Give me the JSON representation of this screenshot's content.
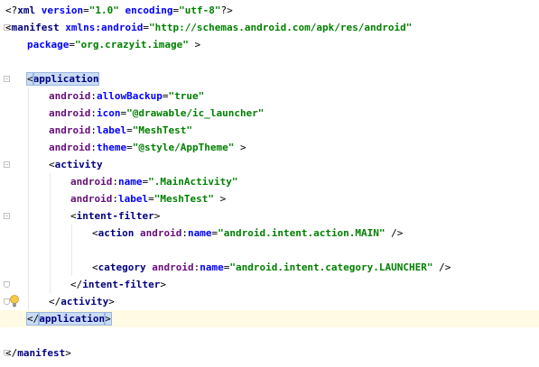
{
  "editor": {
    "lines": [
      {
        "parts": [
          [
            "punct",
            "<?"
          ],
          [
            "tag",
            "xml"
          ],
          [
            "punct",
            " "
          ],
          [
            "attr",
            "version"
          ],
          [
            "punct",
            "="
          ],
          [
            "val",
            "\"1.0\""
          ],
          [
            "punct",
            " "
          ],
          [
            "attr",
            "encoding"
          ],
          [
            "punct",
            "="
          ],
          [
            "val",
            "\"utf-8\""
          ],
          [
            "punct",
            "?>"
          ]
        ]
      },
      {
        "parts": [
          [
            "punct",
            "<"
          ],
          [
            "tag",
            "manifest"
          ],
          [
            "punct",
            " "
          ],
          [
            "attr",
            "xmlns:android"
          ],
          [
            "punct",
            "="
          ],
          [
            "val",
            "\"http://schemas.android.com/apk/res/android\""
          ]
        ]
      },
      {
        "parts": [
          [
            "attr",
            "package"
          ],
          [
            "punct",
            "="
          ],
          [
            "val",
            "\"org.crazyit.image\""
          ],
          [
            "punct",
            " >"
          ]
        ]
      },
      {
        "parts": []
      },
      {
        "parts": [
          [
            "punct",
            "<"
          ],
          [
            "tag",
            "application"
          ]
        ]
      },
      {
        "parts": [
          [
            "ns",
            "android"
          ],
          [
            "punct",
            ":"
          ],
          [
            "attr",
            "allowBackup"
          ],
          [
            "punct",
            "="
          ],
          [
            "val",
            "\"true\""
          ]
        ]
      },
      {
        "parts": [
          [
            "ns",
            "android"
          ],
          [
            "punct",
            ":"
          ],
          [
            "attr",
            "icon"
          ],
          [
            "punct",
            "="
          ],
          [
            "val",
            "\"@drawable/ic_launcher\""
          ]
        ]
      },
      {
        "parts": [
          [
            "ns",
            "android"
          ],
          [
            "punct",
            ":"
          ],
          [
            "attr",
            "label"
          ],
          [
            "punct",
            "="
          ],
          [
            "val",
            "\"MeshTest\""
          ]
        ]
      },
      {
        "parts": [
          [
            "ns",
            "android"
          ],
          [
            "punct",
            ":"
          ],
          [
            "attr",
            "theme"
          ],
          [
            "punct",
            "="
          ],
          [
            "val",
            "\"@style/AppTheme\""
          ],
          [
            "punct",
            " >"
          ]
        ]
      },
      {
        "parts": [
          [
            "punct",
            "<"
          ],
          [
            "tag",
            "activity"
          ]
        ]
      },
      {
        "parts": [
          [
            "ns",
            "android"
          ],
          [
            "punct",
            ":"
          ],
          [
            "attr",
            "name"
          ],
          [
            "punct",
            "="
          ],
          [
            "val",
            "\".MainActivity\""
          ]
        ]
      },
      {
        "parts": [
          [
            "ns",
            "android"
          ],
          [
            "punct",
            ":"
          ],
          [
            "attr",
            "label"
          ],
          [
            "punct",
            "="
          ],
          [
            "val",
            "\"MeshTest\""
          ],
          [
            "punct",
            " >"
          ]
        ]
      },
      {
        "parts": [
          [
            "punct",
            "<"
          ],
          [
            "tag",
            "intent-filter"
          ],
          [
            "punct",
            ">"
          ]
        ]
      },
      {
        "parts": [
          [
            "punct",
            "<"
          ],
          [
            "tag",
            "action"
          ],
          [
            "punct",
            " "
          ],
          [
            "ns",
            "android"
          ],
          [
            "punct",
            ":"
          ],
          [
            "attr",
            "name"
          ],
          [
            "punct",
            "="
          ],
          [
            "val",
            "\"android.intent.action.MAIN\""
          ],
          [
            "punct",
            " />"
          ]
        ]
      },
      {
        "parts": []
      },
      {
        "parts": [
          [
            "punct",
            "<"
          ],
          [
            "tag",
            "category"
          ],
          [
            "punct",
            " "
          ],
          [
            "ns",
            "android"
          ],
          [
            "punct",
            ":"
          ],
          [
            "attr",
            "name"
          ],
          [
            "punct",
            "="
          ],
          [
            "val",
            "\"android.intent.category.LAUNCHER\""
          ],
          [
            "punct",
            " />"
          ]
        ]
      },
      {
        "parts": [
          [
            "punct",
            "</"
          ],
          [
            "tag",
            "intent-filter"
          ],
          [
            "punct",
            ">"
          ]
        ]
      },
      {
        "parts": [
          [
            "punct",
            "</"
          ],
          [
            "tag",
            "activity"
          ],
          [
            "punct",
            ">"
          ]
        ]
      },
      {
        "parts": [
          [
            "punct",
            "</"
          ],
          [
            "tag",
            "application"
          ],
          [
            "punct",
            ">"
          ]
        ]
      },
      {
        "parts": []
      },
      {
        "parts": [
          [
            "punct",
            "</"
          ],
          [
            "tag",
            "manifest"
          ],
          [
            "punct",
            ">"
          ]
        ]
      }
    ]
  },
  "colors": {
    "tag": "#000080",
    "attribute": "#0000ff",
    "namespace": "#660e7a",
    "value": "#008000",
    "current_line": "#fffae3",
    "brace_match": "#c9dcf4"
  },
  "icons": {
    "intention_bulb": "lightbulb-icon",
    "fold_marker": "fold-toggle-icon"
  }
}
